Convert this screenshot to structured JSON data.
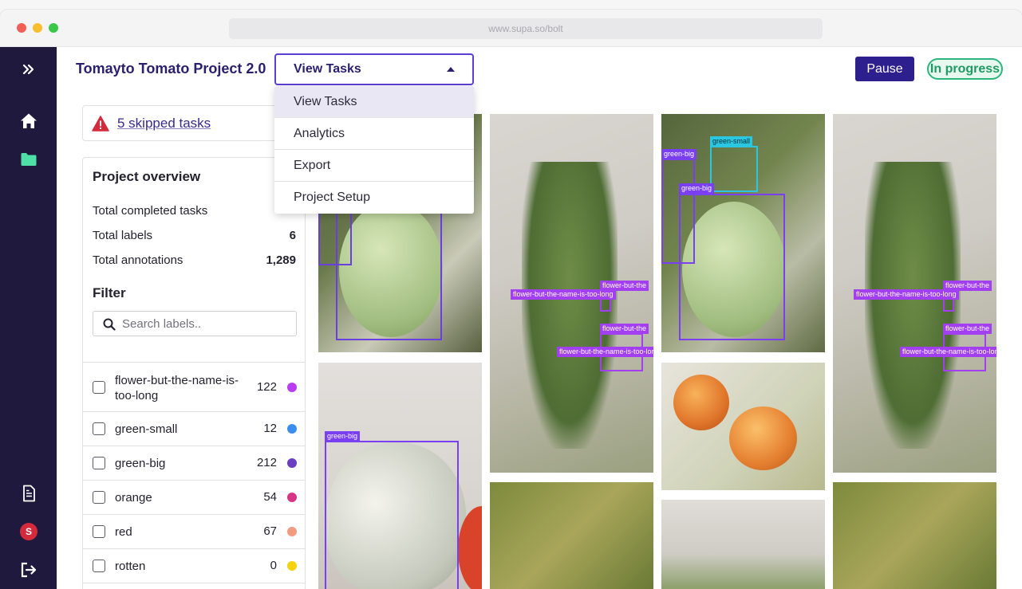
{
  "browser": {
    "url": "www.supa.so/bolt"
  },
  "header": {
    "project_title": "Tomayto Tomato Project 2.0",
    "view_select": "View Tasks",
    "pause_label": "Pause",
    "status": "In progress"
  },
  "dropdown": {
    "items": [
      {
        "label": "View Tasks",
        "active": true
      },
      {
        "label": "Analytics"
      },
      {
        "label": "Export"
      },
      {
        "label": "Project Setup"
      }
    ]
  },
  "skipped": {
    "text": "5 skipped tasks"
  },
  "overview": {
    "title": "Project overview",
    "stats": [
      {
        "label": "Total completed tasks",
        "value": ""
      },
      {
        "label": "Total labels",
        "value": "6"
      },
      {
        "label": "Total annotations",
        "value": "1,289"
      }
    ]
  },
  "filter": {
    "title": "Filter",
    "search_placeholder": "Search labels..",
    "labels": [
      {
        "name": "flower-but-the-name-is-too-long",
        "count": "122",
        "color": "#b83df0"
      },
      {
        "name": "green-small",
        "count": "12",
        "color": "#3b8ef0"
      },
      {
        "name": "green-big",
        "count": "212",
        "color": "#6a3fc2"
      },
      {
        "name": "orange",
        "count": "54",
        "color": "#d43588"
      },
      {
        "name": "red",
        "count": "67",
        "color": "#f29b80"
      },
      {
        "name": "rotten",
        "count": "0",
        "color": "#f5d20a"
      }
    ]
  },
  "annotation_tags": {
    "flower": "flower-but-the-name-is-too-long",
    "flower_short": "flower-but-the",
    "flower_mid": "flower-but-the-name-is-too-long",
    "green_small": "green-small",
    "green_big": "green-big"
  },
  "colors": {
    "sidebar": "#1f1a3d",
    "accent": "#5b3fd3",
    "status_green": "#2cb67d",
    "bbox_purple": "#7a3ff0",
    "bbox_cyan": "#2bc6df"
  }
}
